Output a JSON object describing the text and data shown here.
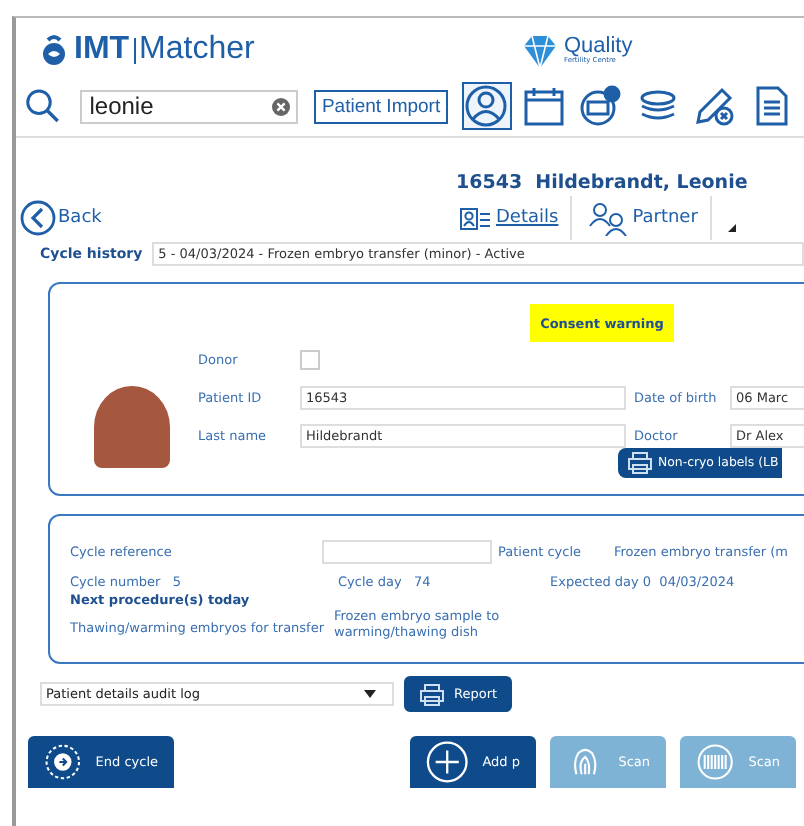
{
  "header": {
    "brand_bold": "IMT",
    "brand": "Matcher",
    "clinic_name": "Quality",
    "clinic_subtitle": "Fertility Centre"
  },
  "search": {
    "value": "leonie"
  },
  "import_button": "Patient Import",
  "toolbar": [
    {
      "kind": "person",
      "selected": true
    },
    {
      "kind": "calendar",
      "selected": false
    },
    {
      "kind": "monitor",
      "selected": false
    },
    {
      "kind": "dish",
      "selected": false
    },
    {
      "kind": "pen",
      "selected": false
    },
    {
      "kind": "document",
      "selected": false
    }
  ],
  "patient": {
    "id": "16543",
    "name": "Hildebrandt, Leonie"
  },
  "back": "Back",
  "nav_tabs": [
    {
      "kind": "details",
      "label": "Details",
      "selected": true
    },
    {
      "kind": "partner",
      "label": "Partner",
      "selected": false
    }
  ],
  "cycle_history": {
    "label": "Cycle history",
    "value": "5 - 04/03/2024 - Frozen embryo transfer (minor) - Active"
  },
  "patient_card": {
    "consent_warning": "Consent warning",
    "donor": {
      "label": "Donor",
      "checked": false
    },
    "rows": [
      {
        "left": {
          "label": "Patient ID",
          "value": "16543"
        },
        "right": {
          "label": "Date of birth",
          "value": "06 Marc"
        }
      },
      {
        "left": {
          "label": "Last name",
          "value": "Hildebrandt"
        },
        "right": {
          "label": "Doctor",
          "value": "Dr Alex"
        }
      }
    ],
    "labels_button": "Non-cryo labels (LB"
  },
  "cycle_card": {
    "reference_label": "Cycle reference",
    "patient_cycle": {
      "label": "Patient cycle",
      "value": "Frozen embryo transfer (m"
    },
    "cycle_number": {
      "label": "Cycle number",
      "value": "5"
    },
    "cycle_day": {
      "label": "Cycle day",
      "value": "74"
    },
    "expected_day": {
      "label": "Expected day 0",
      "value": "04/03/2024"
    },
    "next_heading": "Next procedure(s) today",
    "procedures": [
      {
        "name": "Thawing/warming embryos for transfer",
        "step": "Frozen embryo sample to warming/thawing dish"
      }
    ]
  },
  "audit": {
    "value": "Patient details audit log"
  },
  "report_button": "Report",
  "actions": [
    {
      "kind": "end",
      "label": "End cycle",
      "disabled": false
    },
    {
      "kind": "add",
      "label": "Add p",
      "disabled": false
    },
    {
      "kind": "fingerprint",
      "label": "Scan",
      "disabled": true
    },
    {
      "kind": "barcode",
      "label": "Scan",
      "disabled": true
    }
  ]
}
